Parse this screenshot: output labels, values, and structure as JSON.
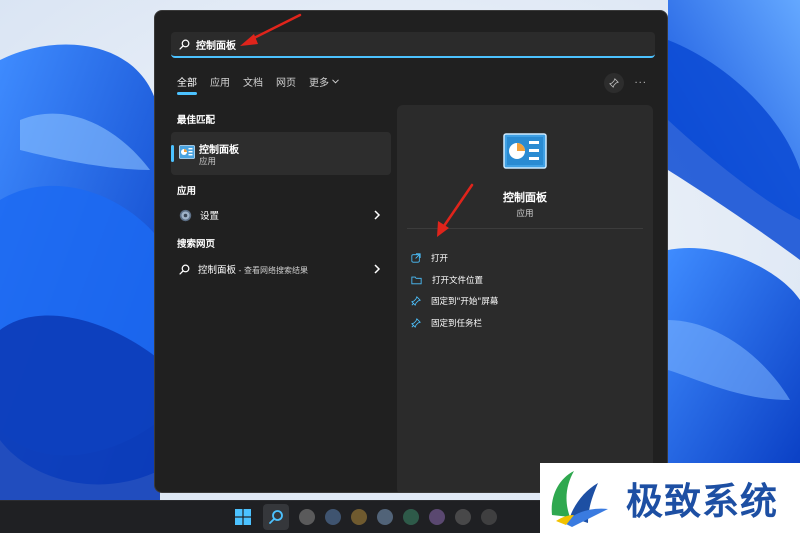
{
  "search": {
    "query": "控制面板"
  },
  "tabs": [
    {
      "label": "全部",
      "active": true
    },
    {
      "label": "应用",
      "active": false
    },
    {
      "label": "文档",
      "active": false
    },
    {
      "label": "网页",
      "active": false
    },
    {
      "label": "更多",
      "active": false
    }
  ],
  "header_right": {
    "more_menu_label": "···"
  },
  "best_match": {
    "section_title": "最佳匹配",
    "name": "控制面板",
    "type": "应用"
  },
  "apps": {
    "section_title": "应用",
    "items": [
      {
        "label": "设置",
        "icon": "gear-icon"
      }
    ]
  },
  "web": {
    "section_title": "搜索网页",
    "query": "控制面板",
    "suffix": " - 查看网络搜索结果"
  },
  "detail": {
    "name": "控制面板",
    "type": "应用",
    "actions": [
      {
        "label": "打开",
        "icon": "open-external-icon"
      },
      {
        "label": "打开文件位置",
        "icon": "folder-icon"
      },
      {
        "label": "固定到\"开始\"屏幕",
        "icon": "pin-icon"
      },
      {
        "label": "固定到任务栏",
        "icon": "pin-icon"
      }
    ]
  },
  "watermark": {
    "text": "极致系统"
  },
  "colors": {
    "accent": "#4cc2ff",
    "panel_bg": "#202020",
    "card_bg": "#2d2d2d",
    "annotation_red": "#e0241b",
    "watermark_blue": "#1d4fa3",
    "wallpaper_blue": "#1a5fe0"
  }
}
